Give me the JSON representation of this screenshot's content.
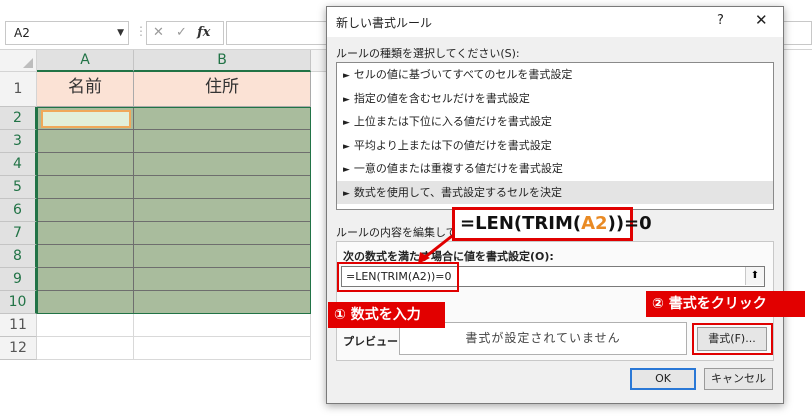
{
  "formula_bar": {
    "name_box": "A2",
    "fx": "fx"
  },
  "sheet": {
    "columns": [
      "A",
      "B"
    ],
    "rows": [
      "1",
      "2",
      "3",
      "4",
      "5",
      "6",
      "7",
      "8",
      "9",
      "10",
      "11",
      "12"
    ],
    "header_cells": [
      "名前",
      "住所"
    ]
  },
  "dialog": {
    "title": "新しい書式ルール",
    "help": "?",
    "close": "✕",
    "rule_type_label": "ルールの種類を選択してください(S):",
    "rule_types": [
      "セルの値に基づいてすべてのセルを書式設定",
      "指定の値を含むセルだけを書式設定",
      "上位または下位に入る値だけを書式設定",
      "平均より上または下の値だけを書式設定",
      "一意の値または重複する値だけを書式設定",
      "数式を使用して、書式設定するセルを決定"
    ],
    "edit_label": "ルールの内容を編集してくだ",
    "formula_label": "次の数式を満たす場合に値を書式設定(O):",
    "formula_value": "=LEN(TRIM(A2))=0",
    "preview_label": "プレビュー:",
    "preview_text": "書式が設定されていません",
    "format_button": "書式(F)...",
    "ok_button": "OK",
    "cancel_button": "キャンセル"
  },
  "annotations": {
    "callout_prefix": "=LEN(TRIM(",
    "callout_ref": "A2",
    "callout_suffix": "))=0",
    "step1": "① 数式を入力",
    "step2": "② 書式をクリック"
  },
  "colors": {
    "header_fill": "#fbe2d5",
    "data_fill": "#a9bc9d",
    "active_fill": "#e2efda",
    "excel_green": "#217346",
    "annotation_red": "#e00000",
    "ref_orange": "#e98a24"
  }
}
